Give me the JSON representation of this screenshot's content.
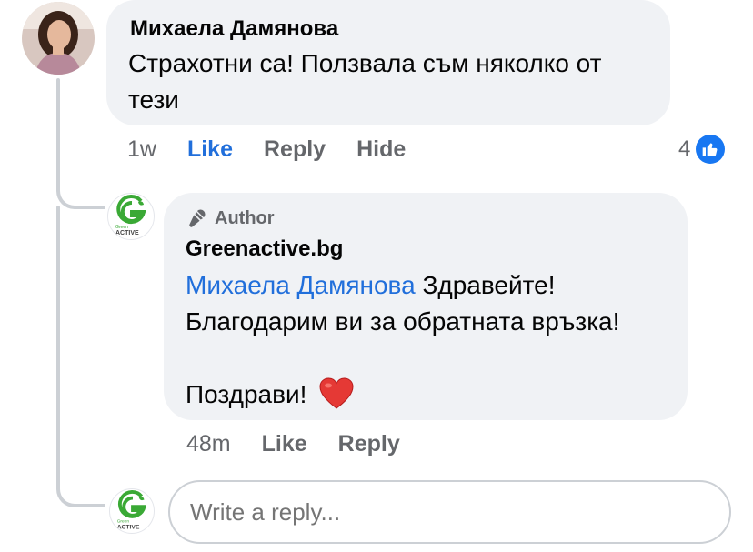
{
  "comment": {
    "author": "Михаела Дамянова",
    "text": "Страхотни са! Ползвала съм няколко от тези",
    "time": "1w",
    "actions": {
      "like": "Like",
      "reply": "Reply",
      "hide": "Hide"
    },
    "reaction_count": "4"
  },
  "reply": {
    "badge": "Author",
    "author": "Greenactive.bg",
    "mention": "Михаела Дамянова",
    "line1": " Здравейте!",
    "line2": "Благодарим ви за обратната връзка!",
    "line3": "Поздрави!",
    "time": "48m",
    "actions": {
      "like": "Like",
      "reply": "Reply"
    }
  },
  "brand_logo": {
    "top": "Green",
    "bottom": "ACTIVE"
  },
  "reply_box": {
    "placeholder": "Write a reply..."
  },
  "colors": {
    "accent": "#216fdb",
    "bubble": "#f0f2f5",
    "muted": "#65676b",
    "brand": "#3aa935"
  }
}
